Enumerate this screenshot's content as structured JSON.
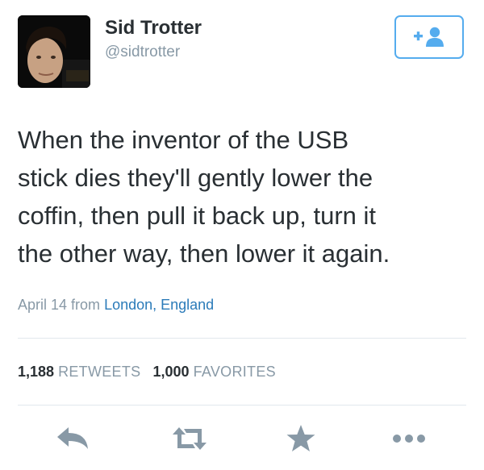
{
  "user": {
    "display_name": "Sid Trotter",
    "handle": "@sidtrotter",
    "avatar": "avatar-photo"
  },
  "follow_button": {
    "icon": "add-user-icon",
    "color": "#55acee"
  },
  "tweet": {
    "lines": [
      "When the inventor of the USB",
      "stick dies they'll gently lower the",
      "coffin, then pull it back up, turn it",
      "the other way, then lower it again."
    ]
  },
  "meta": {
    "date": "April 14",
    "from_label": "from",
    "location": "London, England"
  },
  "stats": {
    "retweets_count": "1,188",
    "retweets_label": "RETWEETS",
    "favorites_count": "1,000",
    "favorites_label": "FAVORITES"
  },
  "actions": [
    {
      "icon": "reply-icon"
    },
    {
      "icon": "retweet-icon"
    },
    {
      "icon": "favorite-star-icon"
    },
    {
      "icon": "more-options-icon"
    }
  ],
  "colors": {
    "text": "#292f33",
    "muted": "#8899a6",
    "link": "#2b7bb9",
    "icon_gray": "#8899a6",
    "divider": "#e1e8ed"
  }
}
